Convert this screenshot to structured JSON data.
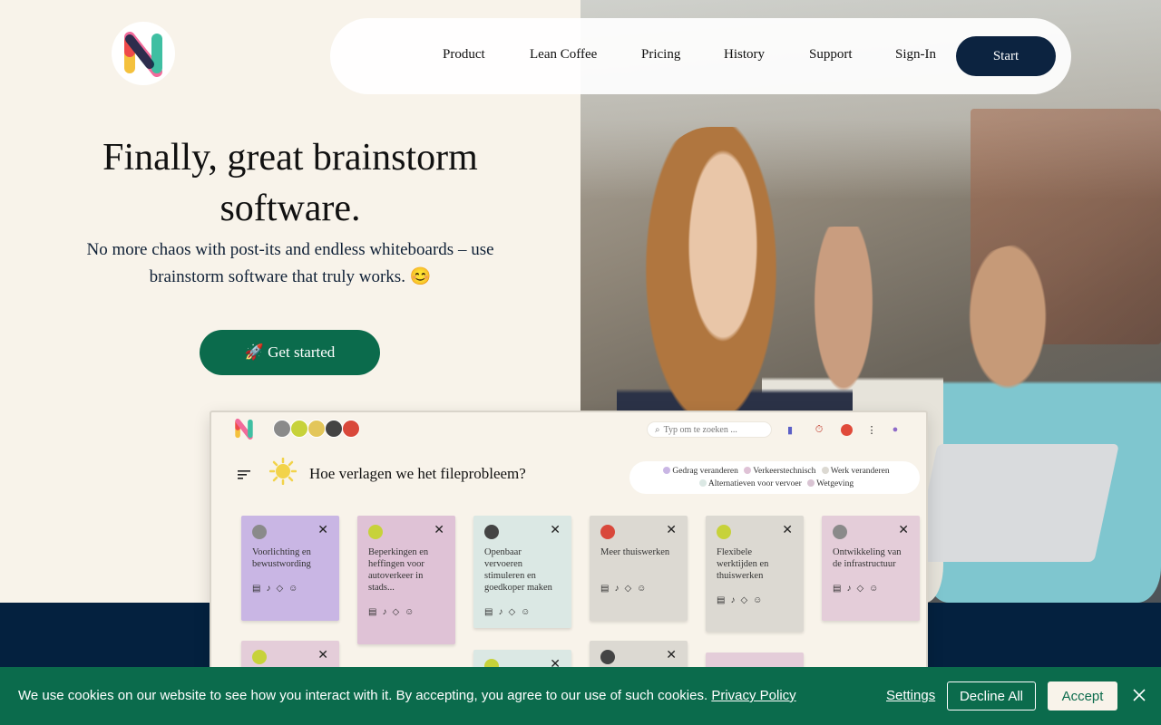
{
  "nav": {
    "items": [
      "Product",
      "Lean Coffee",
      "Pricing",
      "History",
      "Support",
      "Sign-In"
    ],
    "start_label": "Start"
  },
  "hero": {
    "title": "Finally, great brainstorm software.",
    "subtitle": "No more chaos with post-its and endless whiteboards – use brainstorm software that truly works. 😊",
    "cta_label": "🚀 Get started"
  },
  "app": {
    "search_placeholder": "Typ om te zoeken ...",
    "question": "Hoe verlagen we het fileprobleem?",
    "legend": [
      {
        "label": "Gedrag veranderen",
        "color": "#c9b6e4"
      },
      {
        "label": "Verkeerstechnisch",
        "color": "#dfc2d6"
      },
      {
        "label": "Werk veranderen",
        "color": "#dcd9d2"
      },
      {
        "label": "Alternatieven voor vervoer",
        "color": "#dbe8e4"
      },
      {
        "label": "Wetgeving",
        "color": "#d9c4d3"
      }
    ],
    "cards": [
      {
        "text": "Voorlichting en bewustwording",
        "color": "#c9b6e4"
      },
      {
        "text": "Beperkingen en heffingen voor autoverkeer in stads...",
        "color": "#dfc2d6"
      },
      {
        "text": "Openbaar vervoeren stimuleren en goedkoper maken",
        "color": "#dbe8e4"
      },
      {
        "text": "Meer thuiswerken",
        "color": "#dcd9d2"
      },
      {
        "text": "Flexibele werktijden en thuiswerken",
        "color": "#dcd9d2"
      },
      {
        "text": "Ontwikkeling van de infrastructuur",
        "color": "#e4cdd9"
      }
    ]
  },
  "cookie": {
    "message": "We use cookies on our website to see how you interact with it. By accepting, you agree to our use of such cookies.",
    "policy_link": "Privacy Policy",
    "settings_label": "Settings",
    "decline_label": "Decline All",
    "accept_label": "Accept"
  }
}
